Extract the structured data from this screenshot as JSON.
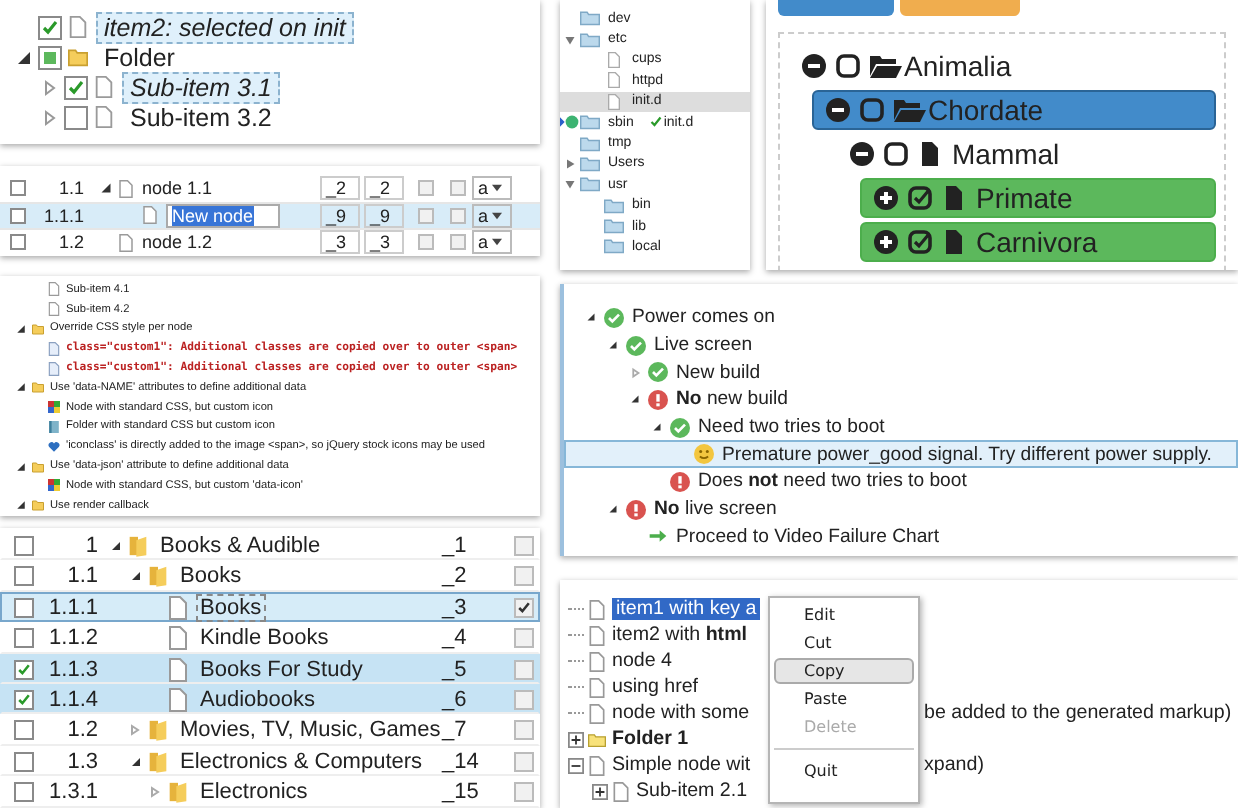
{
  "checkbox_tree": {
    "items": [
      {
        "label": "item2: selected on init",
        "kind": "file",
        "checked": true,
        "partial": false,
        "selected": true
      },
      {
        "label": "Folder",
        "kind": "folder",
        "expanded": true,
        "checked": false,
        "partial": true,
        "selected": false,
        "children": [
          {
            "label": "Sub-item 3.1",
            "kind": "file",
            "expanded": false,
            "checked": true,
            "partial": false,
            "selected": true
          },
          {
            "label": "Sub-item 3.2",
            "kind": "file",
            "expanded": false,
            "checked": false,
            "partial": false,
            "selected": false
          }
        ]
      }
    ]
  },
  "table_tree": {
    "rows": [
      {
        "number": "1.1",
        "title": "node 1.1",
        "expanded": true,
        "column_3": "_2",
        "column_4": "_2",
        "checked": false,
        "flag_1": false,
        "flag_2": false,
        "choice": "a",
        "selected": false,
        "editing": false,
        "children": [
          {
            "number": "1.1.1",
            "title": "New node",
            "column_3": "_9",
            "column_4": "_9",
            "checked": false,
            "flag_1": false,
            "flag_2": false,
            "choice": "a",
            "selected": true,
            "editing": true
          }
        ]
      },
      {
        "number": "1.2",
        "title": "node 1.2",
        "column_3": "_3",
        "column_4": "_3",
        "checked": false,
        "flag_1": false,
        "flag_2": false,
        "choice": "a",
        "selected": false,
        "editing": false
      }
    ]
  },
  "file_tree": {
    "items": [
      {
        "label": "dev",
        "kind": "folder",
        "selected": false,
        "drop_target": false
      },
      {
        "label": "etc",
        "kind": "folder",
        "expanded": true,
        "selected": false,
        "drop_target": false,
        "children": [
          {
            "label": "cups",
            "kind": "file",
            "selected": false,
            "drop_target": false
          },
          {
            "label": "httpd",
            "kind": "file",
            "selected": false,
            "drop_target": false
          },
          {
            "label": "init.d",
            "kind": "file",
            "selected": true,
            "drop_target": false
          }
        ]
      },
      {
        "label": "sbin",
        "kind": "folder",
        "selected": false,
        "drop_target": true
      },
      {
        "label": "tmp",
        "kind": "folder",
        "selected": false,
        "drop_target": false
      },
      {
        "label": "Users",
        "kind": "folder",
        "expanded": false,
        "selected": false,
        "drop_target": false
      },
      {
        "label": "usr",
        "kind": "folder",
        "expanded": true,
        "selected": false,
        "drop_target": false,
        "children": [
          {
            "label": "bin",
            "kind": "folder",
            "selected": false,
            "drop_target": false
          },
          {
            "label": "lib",
            "kind": "folder",
            "selected": false,
            "drop_target": false
          },
          {
            "label": "local",
            "kind": "folder",
            "selected": false,
            "drop_target": false
          }
        ]
      }
    ],
    "drag_helper": {
      "label": "init.d"
    }
  },
  "taxonomy_tree": {
    "items": [
      {
        "label": "Animalia",
        "kind": "folder",
        "expanded": true,
        "checked": false,
        "active": false,
        "selected": false,
        "children": [
          {
            "label": "Chordate",
            "kind": "folder",
            "expanded": true,
            "checked": false,
            "active": true,
            "selected": false,
            "children": [
              {
                "label": "Mammal",
                "kind": "file",
                "expanded": true,
                "checked": false,
                "active": false,
                "selected": false,
                "children": [
                  {
                    "label": "Primate",
                    "kind": "file",
                    "expanded": false,
                    "checked": true,
                    "active": false,
                    "selected": true
                  },
                  {
                    "label": "Carnivora",
                    "kind": "file",
                    "expanded": false,
                    "checked": true,
                    "active": false,
                    "selected": true
                  }
                ]
              }
            ]
          }
        ]
      }
    ]
  },
  "css_demo_tree": {
    "continued_items": [
      {
        "label": "Sub-item 4.1",
        "kind": "file"
      },
      {
        "label": "Sub-item 4.2",
        "kind": "file"
      }
    ],
    "items": [
      {
        "label": "Override CSS style per node",
        "kind": "folder",
        "expanded": true,
        "children": [
          {
            "label": "class=\"custom1\": Additional classes are copied over to outer <span>",
            "kind": "custom"
          },
          {
            "label": "class=\"custom1\": Additional classes are copied over to outer <span>",
            "kind": "custom"
          }
        ]
      },
      {
        "label": "Use 'data-NAME' attributes to define additional data",
        "kind": "folder",
        "expanded": true,
        "children": [
          {
            "label": "Node with standard CSS, but custom icon",
            "kind": "image"
          },
          {
            "label": "Folder with standard CSS but custom icon",
            "kind": "book"
          },
          {
            "label": "'iconclass' is directly added to the image <span>, so jQuery stock icons may be used",
            "kind": "heart"
          }
        ]
      },
      {
        "label": "Use 'data-json' attribute to define additional data",
        "kind": "folder",
        "expanded": true,
        "children": [
          {
            "label": "Node with standard CSS, but custom 'data-icon'",
            "kind": "image"
          }
        ]
      },
      {
        "label": "Use render callback",
        "kind": "folder",
        "expanded": true
      }
    ]
  },
  "troubleshooting_tree": {
    "items": [
      {
        "label": "Power comes on",
        "kind": "ok",
        "expanded": true,
        "selected": false,
        "children": [
          {
            "label": "Live screen",
            "kind": "ok",
            "expanded": true,
            "selected": false,
            "children": [
              {
                "label": "New build",
                "kind": "ok",
                "expanded": false,
                "selected": false
              },
              {
                "label": "**No** new build",
                "kind": "error",
                "expanded": true,
                "selected": false,
                "children": [
                  {
                    "label": "Need two tries to boot",
                    "kind": "ok",
                    "expanded": true,
                    "selected": false,
                    "children": [
                      {
                        "label": "Premature power_good signal. Try different power supply.",
                        "kind": "smile",
                        "selected": true
                      }
                    ]
                  },
                  {
                    "label": "Does **not** need two tries to boot",
                    "kind": "error",
                    "selected": false
                  }
                ]
              }
            ]
          },
          {
            "label": "**No** live screen",
            "kind": "error",
            "expanded": true,
            "selected": false,
            "children": [
              {
                "label": "Proceed to Video Failure Chart",
                "kind": "arrow",
                "selected": false
              }
            ]
          }
        ]
      }
    ]
  },
  "books_table": {
    "rows": [
      {
        "number": "1",
        "title": "Books & Audible",
        "kind": "folder",
        "expanded": true,
        "key": "_1",
        "checked": false,
        "selected": false,
        "active": false,
        "flag": false,
        "children": [
          {
            "number": "1.1",
            "title": "Books",
            "kind": "folder",
            "expanded": true,
            "key": "_2",
            "checked": false,
            "selected": false,
            "active": false,
            "flag": false,
            "children": [
              {
                "number": "1.1.1",
                "title": "Books",
                "kind": "file",
                "key": "_3",
                "checked": false,
                "selected": false,
                "active": true,
                "flag": true
              },
              {
                "number": "1.1.2",
                "title": "Kindle Books",
                "kind": "file",
                "key": "_4",
                "checked": false,
                "selected": false,
                "active": false,
                "flag": false
              },
              {
                "number": "1.1.3",
                "title": "Books For Study",
                "kind": "file",
                "key": "_5",
                "checked": true,
                "selected": true,
                "active": false,
                "flag": false
              },
              {
                "number": "1.1.4",
                "title": "Audiobooks",
                "kind": "file",
                "key": "_6",
                "checked": true,
                "selected": true,
                "active": false,
                "flag": false
              }
            ]
          },
          {
            "number": "1.2",
            "title": "Movies, TV, Music, Games",
            "kind": "folder",
            "expanded": false,
            "key": "_7",
            "checked": false,
            "selected": false,
            "active": false,
            "flag": false
          },
          {
            "number": "1.3",
            "title": "Electronics & Computers",
            "kind": "folder",
            "expanded": true,
            "key": "_14",
            "checked": false,
            "selected": false,
            "active": false,
            "flag": false,
            "children": [
              {
                "number": "1.3.1",
                "title": "Electronics",
                "kind": "folder",
                "expanded": false,
                "key": "_15",
                "checked": false,
                "selected": false,
                "active": false,
                "flag": false
              }
            ]
          }
        ]
      }
    ]
  },
  "context_menu_demo": {
    "tree": [
      {
        "label": "item1 with key a",
        "kind": "file",
        "selected": true
      },
      {
        "label": "item2 with **html**",
        "kind": "file",
        "selected": false
      },
      {
        "label": "node 4",
        "kind": "file",
        "selected": false
      },
      {
        "label": "using href",
        "kind": "file",
        "selected": false
      },
      {
        "label": "node with some",
        "tail": "be added to the generated markup)",
        "kind": "file",
        "selected": false
      },
      {
        "label": "Folder 1",
        "kind": "folder",
        "expanded": false,
        "selected": false
      },
      {
        "label": "Simple node wit",
        "tail": "xpand)",
        "kind": "file",
        "expanded": true,
        "selected": false,
        "children": [
          {
            "label": "Sub-item 2.1",
            "kind": "file",
            "expanded": false,
            "selected": false
          }
        ]
      }
    ],
    "menu": [
      {
        "kind": "item",
        "label": "Edit",
        "disabled": false,
        "selected": false
      },
      {
        "kind": "item",
        "label": "Cut",
        "disabled": false,
        "selected": false
      },
      {
        "kind": "item",
        "label": "Copy",
        "disabled": false,
        "selected": true
      },
      {
        "kind": "item",
        "label": "Paste",
        "disabled": false,
        "selected": false
      },
      {
        "kind": "item",
        "label": "Delete",
        "disabled": true,
        "selected": false
      },
      {
        "kind": "separator"
      },
      {
        "kind": "item",
        "label": "Quit",
        "disabled": false,
        "selected": false
      }
    ]
  }
}
